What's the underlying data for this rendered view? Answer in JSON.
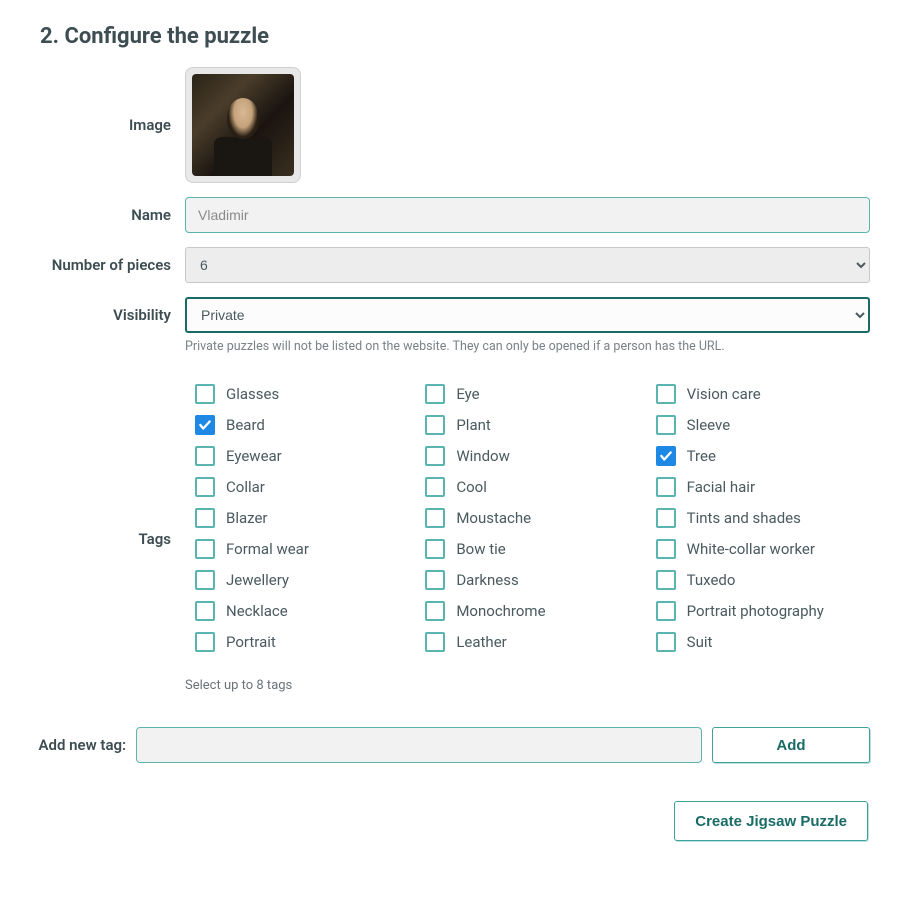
{
  "heading": "2. Configure the puzzle",
  "labels": {
    "image": "Image",
    "name": "Name",
    "pieces": "Number of pieces",
    "visibility": "Visibility",
    "tags": "Tags",
    "add_tag": "Add new tag:"
  },
  "fields": {
    "name_value": "Vladimir",
    "pieces_value": "6",
    "visibility_value": "Private",
    "pieces_options": [
      "6"
    ],
    "visibility_options": [
      "Private"
    ],
    "visibility_helper": "Private puzzles will not be listed on the website. They can only be opened if a person has the URL."
  },
  "tags": {
    "note": "Select up to 8 tags",
    "items": [
      {
        "label": "Glasses",
        "checked": false
      },
      {
        "label": "Beard",
        "checked": true
      },
      {
        "label": "Eyewear",
        "checked": false
      },
      {
        "label": "Collar",
        "checked": false
      },
      {
        "label": "Blazer",
        "checked": false
      },
      {
        "label": "Formal wear",
        "checked": false
      },
      {
        "label": "Jewellery",
        "checked": false
      },
      {
        "label": "Necklace",
        "checked": false
      },
      {
        "label": "Portrait",
        "checked": false
      },
      {
        "label": "Eye",
        "checked": false
      },
      {
        "label": "Plant",
        "checked": false
      },
      {
        "label": "Window",
        "checked": false
      },
      {
        "label": "Cool",
        "checked": false
      },
      {
        "label": "Moustache",
        "checked": false
      },
      {
        "label": "Bow tie",
        "checked": false
      },
      {
        "label": "Darkness",
        "checked": false
      },
      {
        "label": "Monochrome",
        "checked": false
      },
      {
        "label": "Leather",
        "checked": false
      },
      {
        "label": "Vision care",
        "checked": false
      },
      {
        "label": "Sleeve",
        "checked": false
      },
      {
        "label": "Tree",
        "checked": true
      },
      {
        "label": "Facial hair",
        "checked": false
      },
      {
        "label": "Tints and shades",
        "checked": false
      },
      {
        "label": "White-collar worker",
        "checked": false
      },
      {
        "label": "Tuxedo",
        "checked": false
      },
      {
        "label": "Portrait photography",
        "checked": false
      },
      {
        "label": "Suit",
        "checked": false
      }
    ]
  },
  "buttons": {
    "add": "Add",
    "create": "Create Jigsaw Puzzle"
  }
}
